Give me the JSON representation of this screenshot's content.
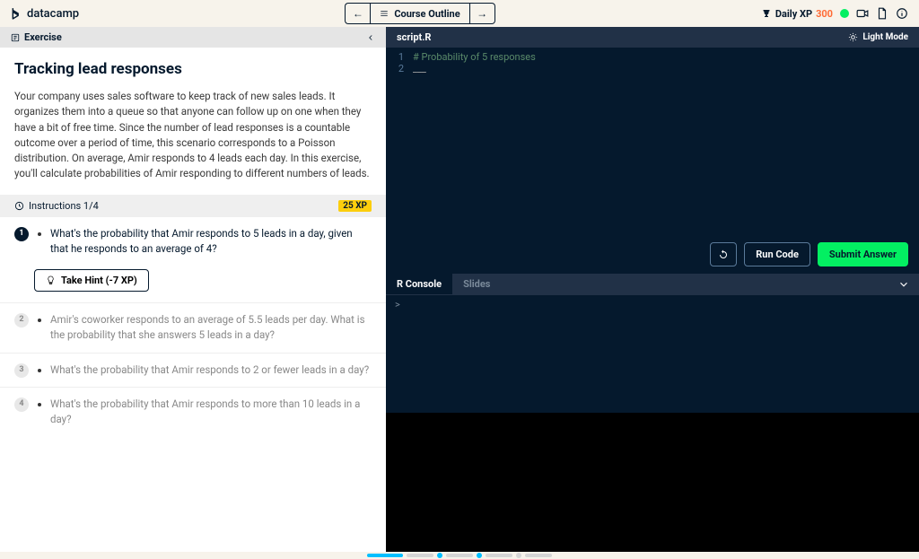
{
  "header": {
    "logo_text": "datacamp",
    "course_outline_label": "Course Outline",
    "daily_xp_label": "Daily XP",
    "daily_xp_value": "300"
  },
  "left_panel": {
    "panel_label": "Exercise",
    "title": "Tracking lead responses",
    "description": "Your company uses sales software to keep track of new sales leads. It organizes them into a queue so that anyone can follow up on one when they have a bit of free time. Since the number of lead responses is a countable outcome over a period of time, this scenario corresponds to a Poisson distribution. On average, Amir responds to 4 leads each day. In this exercise, you'll calculate probabilities of Amir responding to different numbers of leads.",
    "instructions_label": "Instructions 1/4",
    "xp_badge": "25 XP",
    "step1": "What's the probability that Amir responds to 5 leads in a day, given that he responds to an average of 4?",
    "hint_label": "Take Hint (-7 XP)",
    "step2": "Amir's coworker responds to an average of 5.5 leads per day. What is the probability that she answers 5 leads in a day?",
    "step3": "What's the probability that Amir responds to 2 or fewer leads in a day?",
    "step4": "What's the probability that Amir responds to more than 10 leads in a day?"
  },
  "editor": {
    "file_name": "script.R",
    "light_mode_label": "Light Mode",
    "line1_num": "1",
    "line1_text": "# Probability of 5 responses",
    "line2_num": "2",
    "line2_text": "___",
    "run_label": "Run Code",
    "submit_label": "Submit Answer"
  },
  "console": {
    "tab_console": "R Console",
    "tab_slides": "Slides",
    "prompt": ">"
  }
}
